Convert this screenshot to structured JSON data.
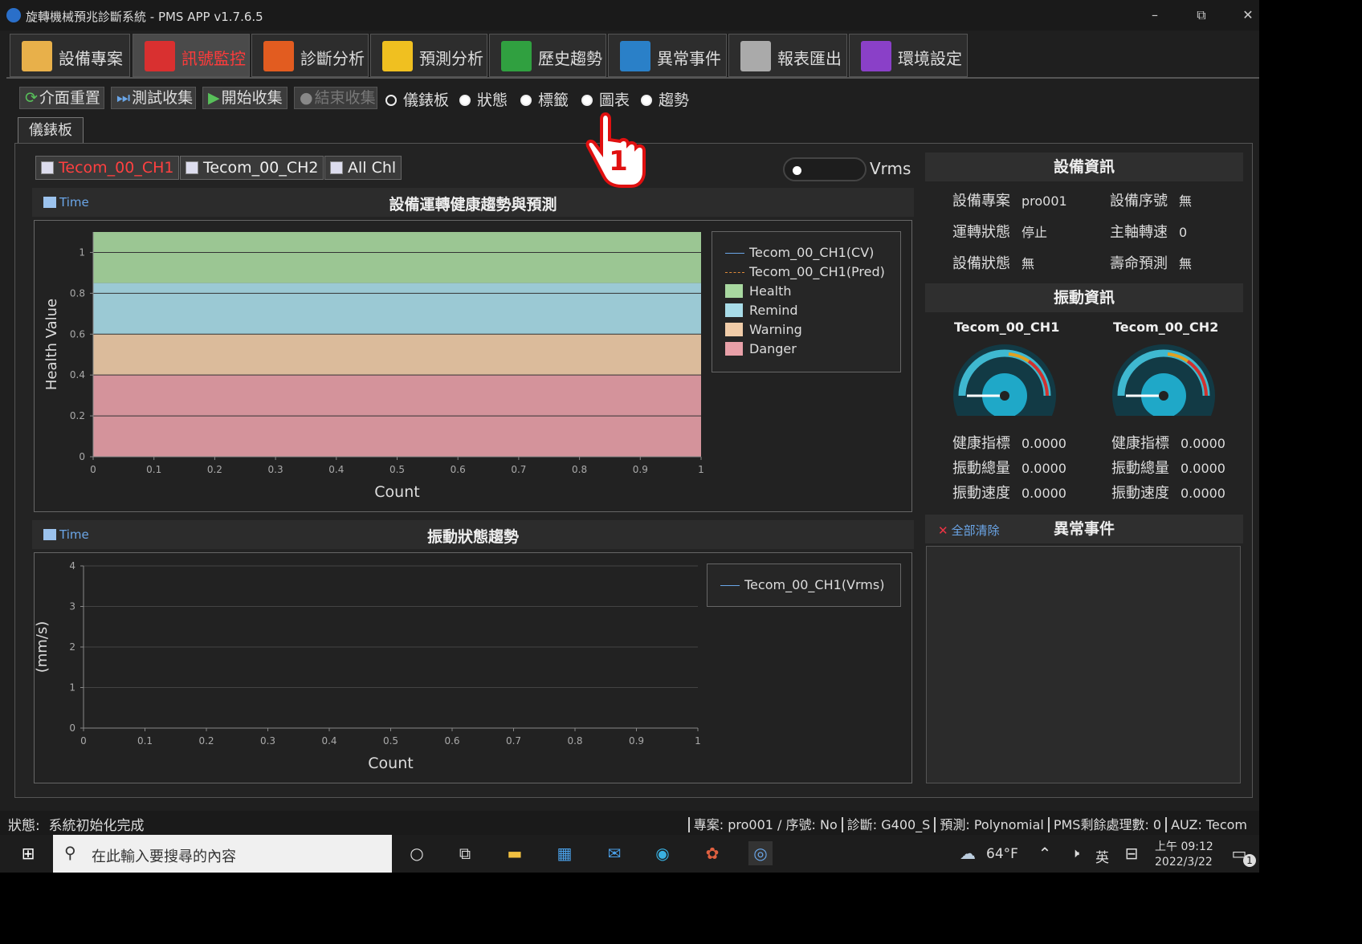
{
  "window": {
    "title": "旋轉機械預兆診斷系統 - PMS APP v1.7.6.5",
    "minimize": "–",
    "restore": "⧉",
    "close": "✕"
  },
  "tabs": [
    {
      "label": "設備專案",
      "color": "#e8b04a"
    },
    {
      "label": "訊號監控",
      "color": "#d93030",
      "active_color": "#ff3b3b"
    },
    {
      "label": "診斷分析",
      "color": "#e25c20"
    },
    {
      "label": "預測分析",
      "color": "#f0c020"
    },
    {
      "label": "歷史趨勢",
      "color": "#30a040"
    },
    {
      "label": "異常事件",
      "color": "#2a80c8"
    },
    {
      "label": "報表匯出",
      "color": "#aaaaaa"
    },
    {
      "label": "環境設定",
      "color": "#8a40c8"
    }
  ],
  "toolbar": {
    "reset": "介面重置",
    "test": "測試收集",
    "start": "開始收集",
    "stop": "結束收集",
    "radios": [
      "儀錶板",
      "狀態",
      "標籤",
      "圖表",
      "趨勢"
    ]
  },
  "subtab": "儀錶板",
  "channels": {
    "ch1": "Tecom_00_CH1",
    "ch2": "Tecom_00_CH2",
    "all": "All Chl"
  },
  "toggle_unit": "Vrms",
  "chart1": {
    "time": "Time",
    "title": "設備運轉健康趨勢與預測",
    "ylabel": "Health Value",
    "xlabel": "Count",
    "legend": [
      "Tecom_00_CH1(CV)",
      "Tecom_00_CH1(Pred)",
      "Health",
      "Remind",
      "Warning",
      "Danger"
    ]
  },
  "chart2": {
    "time": "Time",
    "title": "振動狀態趨勢",
    "ylabel": "(mm/s)",
    "xlabel": "Count",
    "legend": [
      "Tecom_00_CH1(Vrms)"
    ]
  },
  "chart_data": [
    {
      "type": "area",
      "title": "設備運轉健康趨勢與預測",
      "xlabel": "Count",
      "ylabel": "Health Value",
      "xlim": [
        0,
        1
      ],
      "ylim": [
        0,
        1.1
      ],
      "x_ticks": [
        "0",
        "0.1",
        "0.2",
        "0.3",
        "0.4",
        "0.5",
        "0.6",
        "0.7",
        "0.8",
        "0.9",
        "1"
      ],
      "y_ticks": [
        "0",
        "0.2",
        "0.4",
        "0.6",
        "0.8",
        "1"
      ],
      "bands": [
        {
          "name": "Health",
          "from": 0.85,
          "to": 1.1,
          "color": "#a8d8a0"
        },
        {
          "name": "Remind",
          "from": 0.6,
          "to": 0.85,
          "color": "#a8dce8"
        },
        {
          "name": "Warning",
          "from": 0.4,
          "to": 0.6,
          "color": "#f0cca8"
        },
        {
          "name": "Danger",
          "from": 0,
          "to": 0.4,
          "color": "#e8a0a8"
        }
      ],
      "series": [
        {
          "name": "Tecom_00_CH1(CV)",
          "values": []
        },
        {
          "name": "Tecom_00_CH1(Pred)",
          "values": []
        }
      ],
      "legend": "right"
    },
    {
      "type": "line",
      "title": "振動狀態趨勢",
      "xlabel": "Count",
      "ylabel": "(mm/s)",
      "xlim": [
        0,
        1
      ],
      "ylim": [
        0,
        4
      ],
      "x_ticks": [
        "0",
        "0.1",
        "0.2",
        "0.3",
        "0.4",
        "0.5",
        "0.6",
        "0.7",
        "0.8",
        "0.9",
        "1"
      ],
      "y_ticks": [
        "0",
        "1",
        "2",
        "3",
        "4"
      ],
      "series": [
        {
          "name": "Tecom_00_CH1(Vrms)",
          "values": []
        }
      ],
      "legend": "right"
    }
  ],
  "device_info": {
    "title": "設備資訊",
    "rows": [
      [
        "設備專案",
        "pro001",
        "設備序號",
        "無"
      ],
      [
        "運轉狀態",
        "停止",
        "主軸轉速",
        "0"
      ],
      [
        "設備狀態",
        "無",
        "壽命預測",
        "無"
      ]
    ]
  },
  "vibration": {
    "title": "振動資訊",
    "channels": [
      {
        "name": "Tecom_00_CH1",
        "health_label": "健康指標",
        "health": "0.0000",
        "total_label": "振動總量",
        "total": "0.0000",
        "vel_label": "振動速度",
        "vel": "0.0000",
        "gauge": 0
      },
      {
        "name": "Tecom_00_CH2",
        "health_label": "健康指標",
        "health": "0.0000",
        "total_label": "振動總量",
        "total": "0.0000",
        "vel_label": "振動速度",
        "vel": "0.0000",
        "gauge": 0
      }
    ]
  },
  "events": {
    "title": "異常事件",
    "clear": "全部清除"
  },
  "status": {
    "label": "狀態:",
    "text": "系統初始化完成",
    "right": [
      "專案: pro001 / 序號: No",
      "診斷: G400_S",
      "預測: Polynomial",
      "PMS剩餘處理數: 0",
      "AUZ: Tecom"
    ]
  },
  "taskbar": {
    "search": "在此輸入要搜尋的內容",
    "weather": "64°F",
    "ime": "英",
    "time": "上午 09:12",
    "date": "2022/3/22",
    "notif": "1"
  },
  "annotation": "1"
}
